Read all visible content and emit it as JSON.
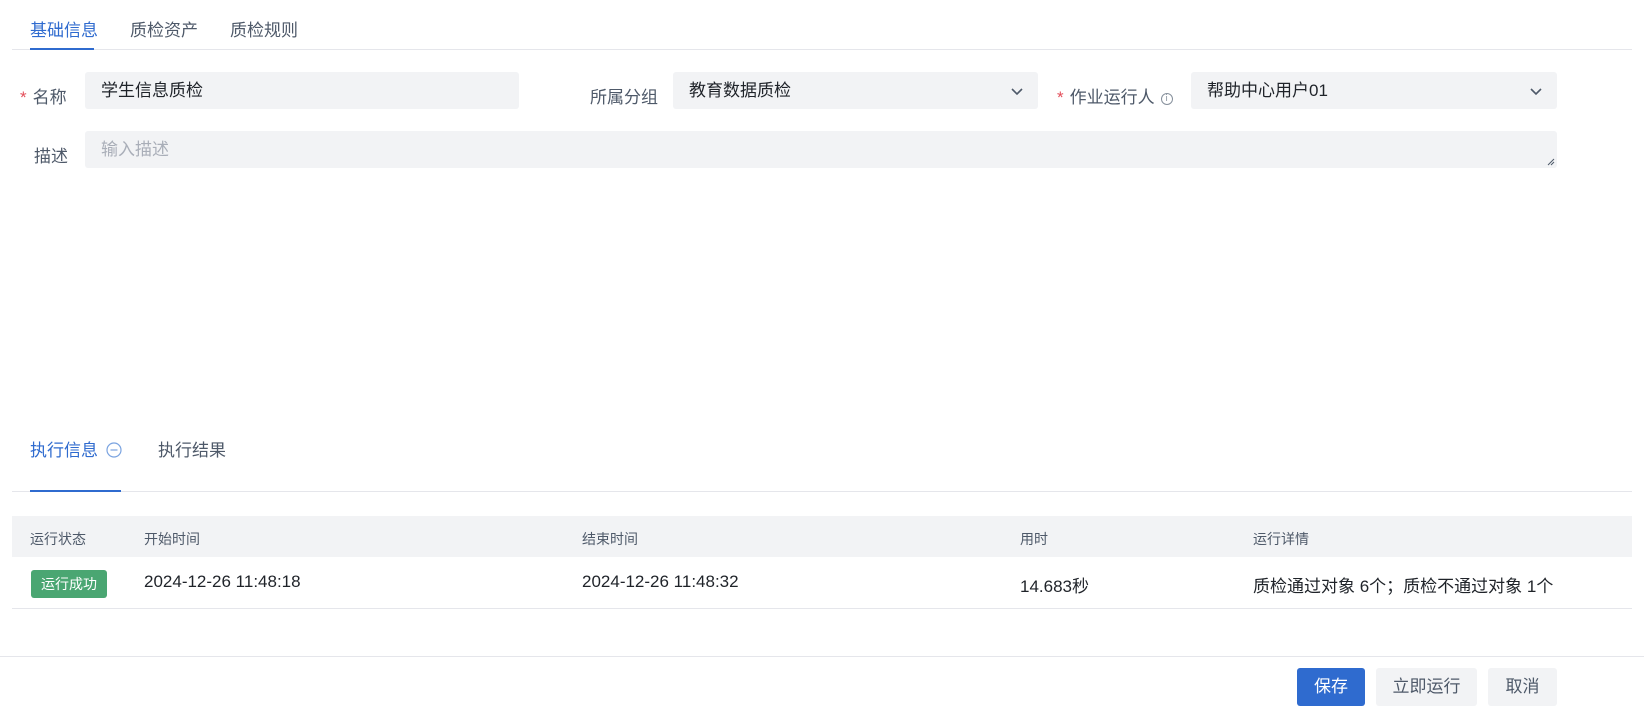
{
  "top_tabs": [
    {
      "label": "基础信息",
      "active": true
    },
    {
      "label": "质检资产",
      "active": false
    },
    {
      "label": "质检规则",
      "active": false
    }
  ],
  "form": {
    "name": {
      "label": "名称",
      "required": true,
      "value": "学生信息质检"
    },
    "group": {
      "label": "所属分组",
      "required": false,
      "value": "教育数据质检"
    },
    "runner": {
      "label": "作业运行人",
      "required": true,
      "value": "帮助中心用户01",
      "info_icon": "info-icon"
    },
    "description": {
      "label": "描述",
      "placeholder": "输入描述",
      "value": ""
    }
  },
  "exec_tabs": [
    {
      "label": "执行信息",
      "active": true,
      "icon": "collapse-circle-icon"
    },
    {
      "label": "执行结果",
      "active": false
    }
  ],
  "table": {
    "columns": [
      "运行状态",
      "开始时间",
      "结束时间",
      "用时",
      "运行详情"
    ],
    "rows": [
      {
        "status": "运行成功",
        "start": "2024-12-26 11:48:18",
        "end": "2024-12-26 11:48:32",
        "duration": "14.683秒",
        "detail": "质检通过对象 6个；质检不通过对象 1个"
      }
    ]
  },
  "footer": {
    "save_label": "保存",
    "run_label": "立即运行",
    "cancel_label": "取消"
  },
  "colors": {
    "accent": "#2f6bcf",
    "success": "#4aa672",
    "required": "#e34d59"
  }
}
